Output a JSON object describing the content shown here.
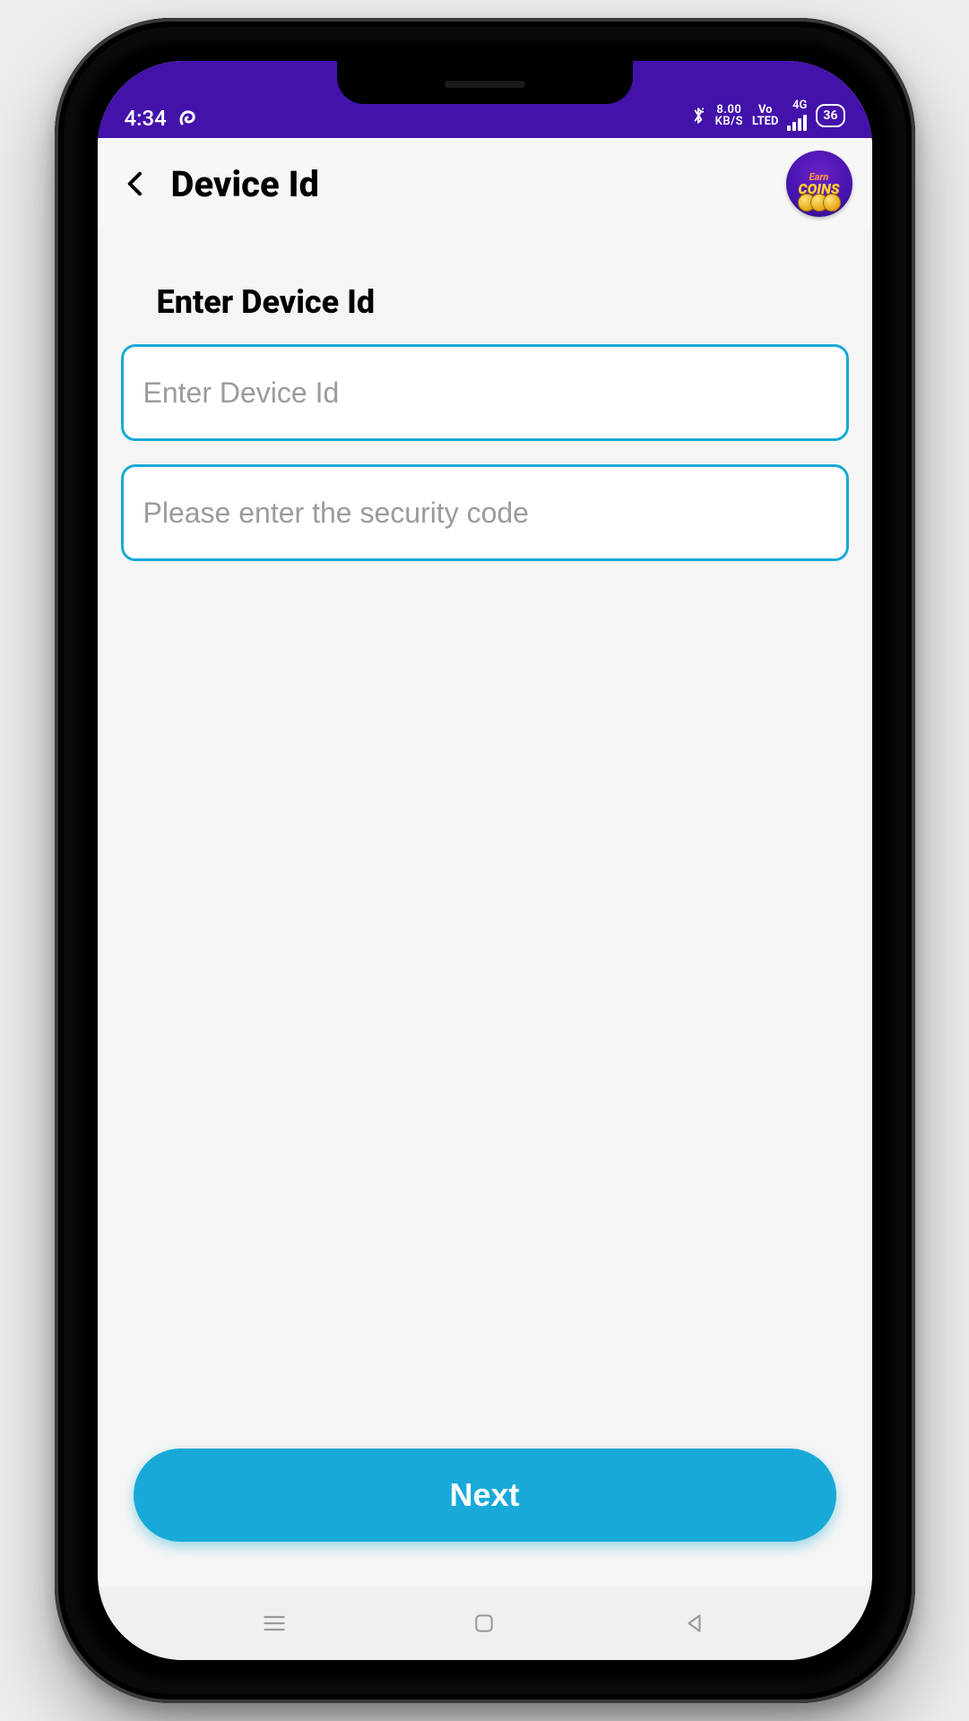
{
  "status": {
    "time": "4:34",
    "kbs_top": "8.00",
    "kbs_bottom": "KB/S",
    "lte_top": "Vo",
    "lte_bottom": "LTED",
    "net_gen": "4G",
    "battery": "36"
  },
  "header": {
    "title": "Device Id",
    "earn_top": "Earn",
    "earn_bottom": "COINS"
  },
  "form": {
    "heading": "Enter Device Id",
    "device_placeholder": "Enter Device Id",
    "security_placeholder": "Please enter the security code"
  },
  "actions": {
    "next_label": "Next"
  }
}
